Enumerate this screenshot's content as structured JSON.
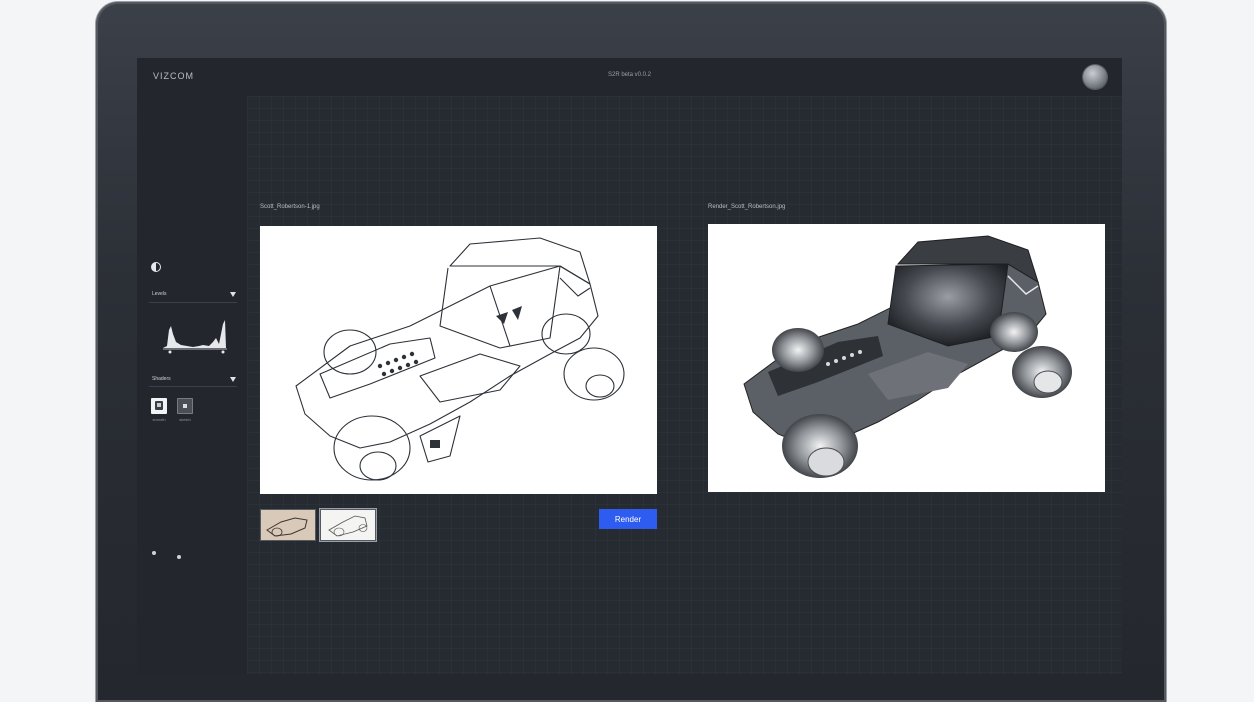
{
  "app": {
    "logo_text": "VIZCOM",
    "title": "S2R beta v0.0.2"
  },
  "sidebar": {
    "levels_label": "Levels",
    "shaders_label": "Shaders",
    "shaders": [
      {
        "name": "smooth",
        "icon": "shader-smooth-icon"
      },
      {
        "name": "sketch",
        "icon": "shader-sketch-icon"
      }
    ]
  },
  "input_panel": {
    "file_name": "Scott_Robertson-1.jpg"
  },
  "output_panel": {
    "file_name": "Render_Scott_Robertson.jpg"
  },
  "actions": {
    "render_label": "Render"
  },
  "colors": {
    "accent": "#2f5cf0",
    "background": "#23262d"
  }
}
